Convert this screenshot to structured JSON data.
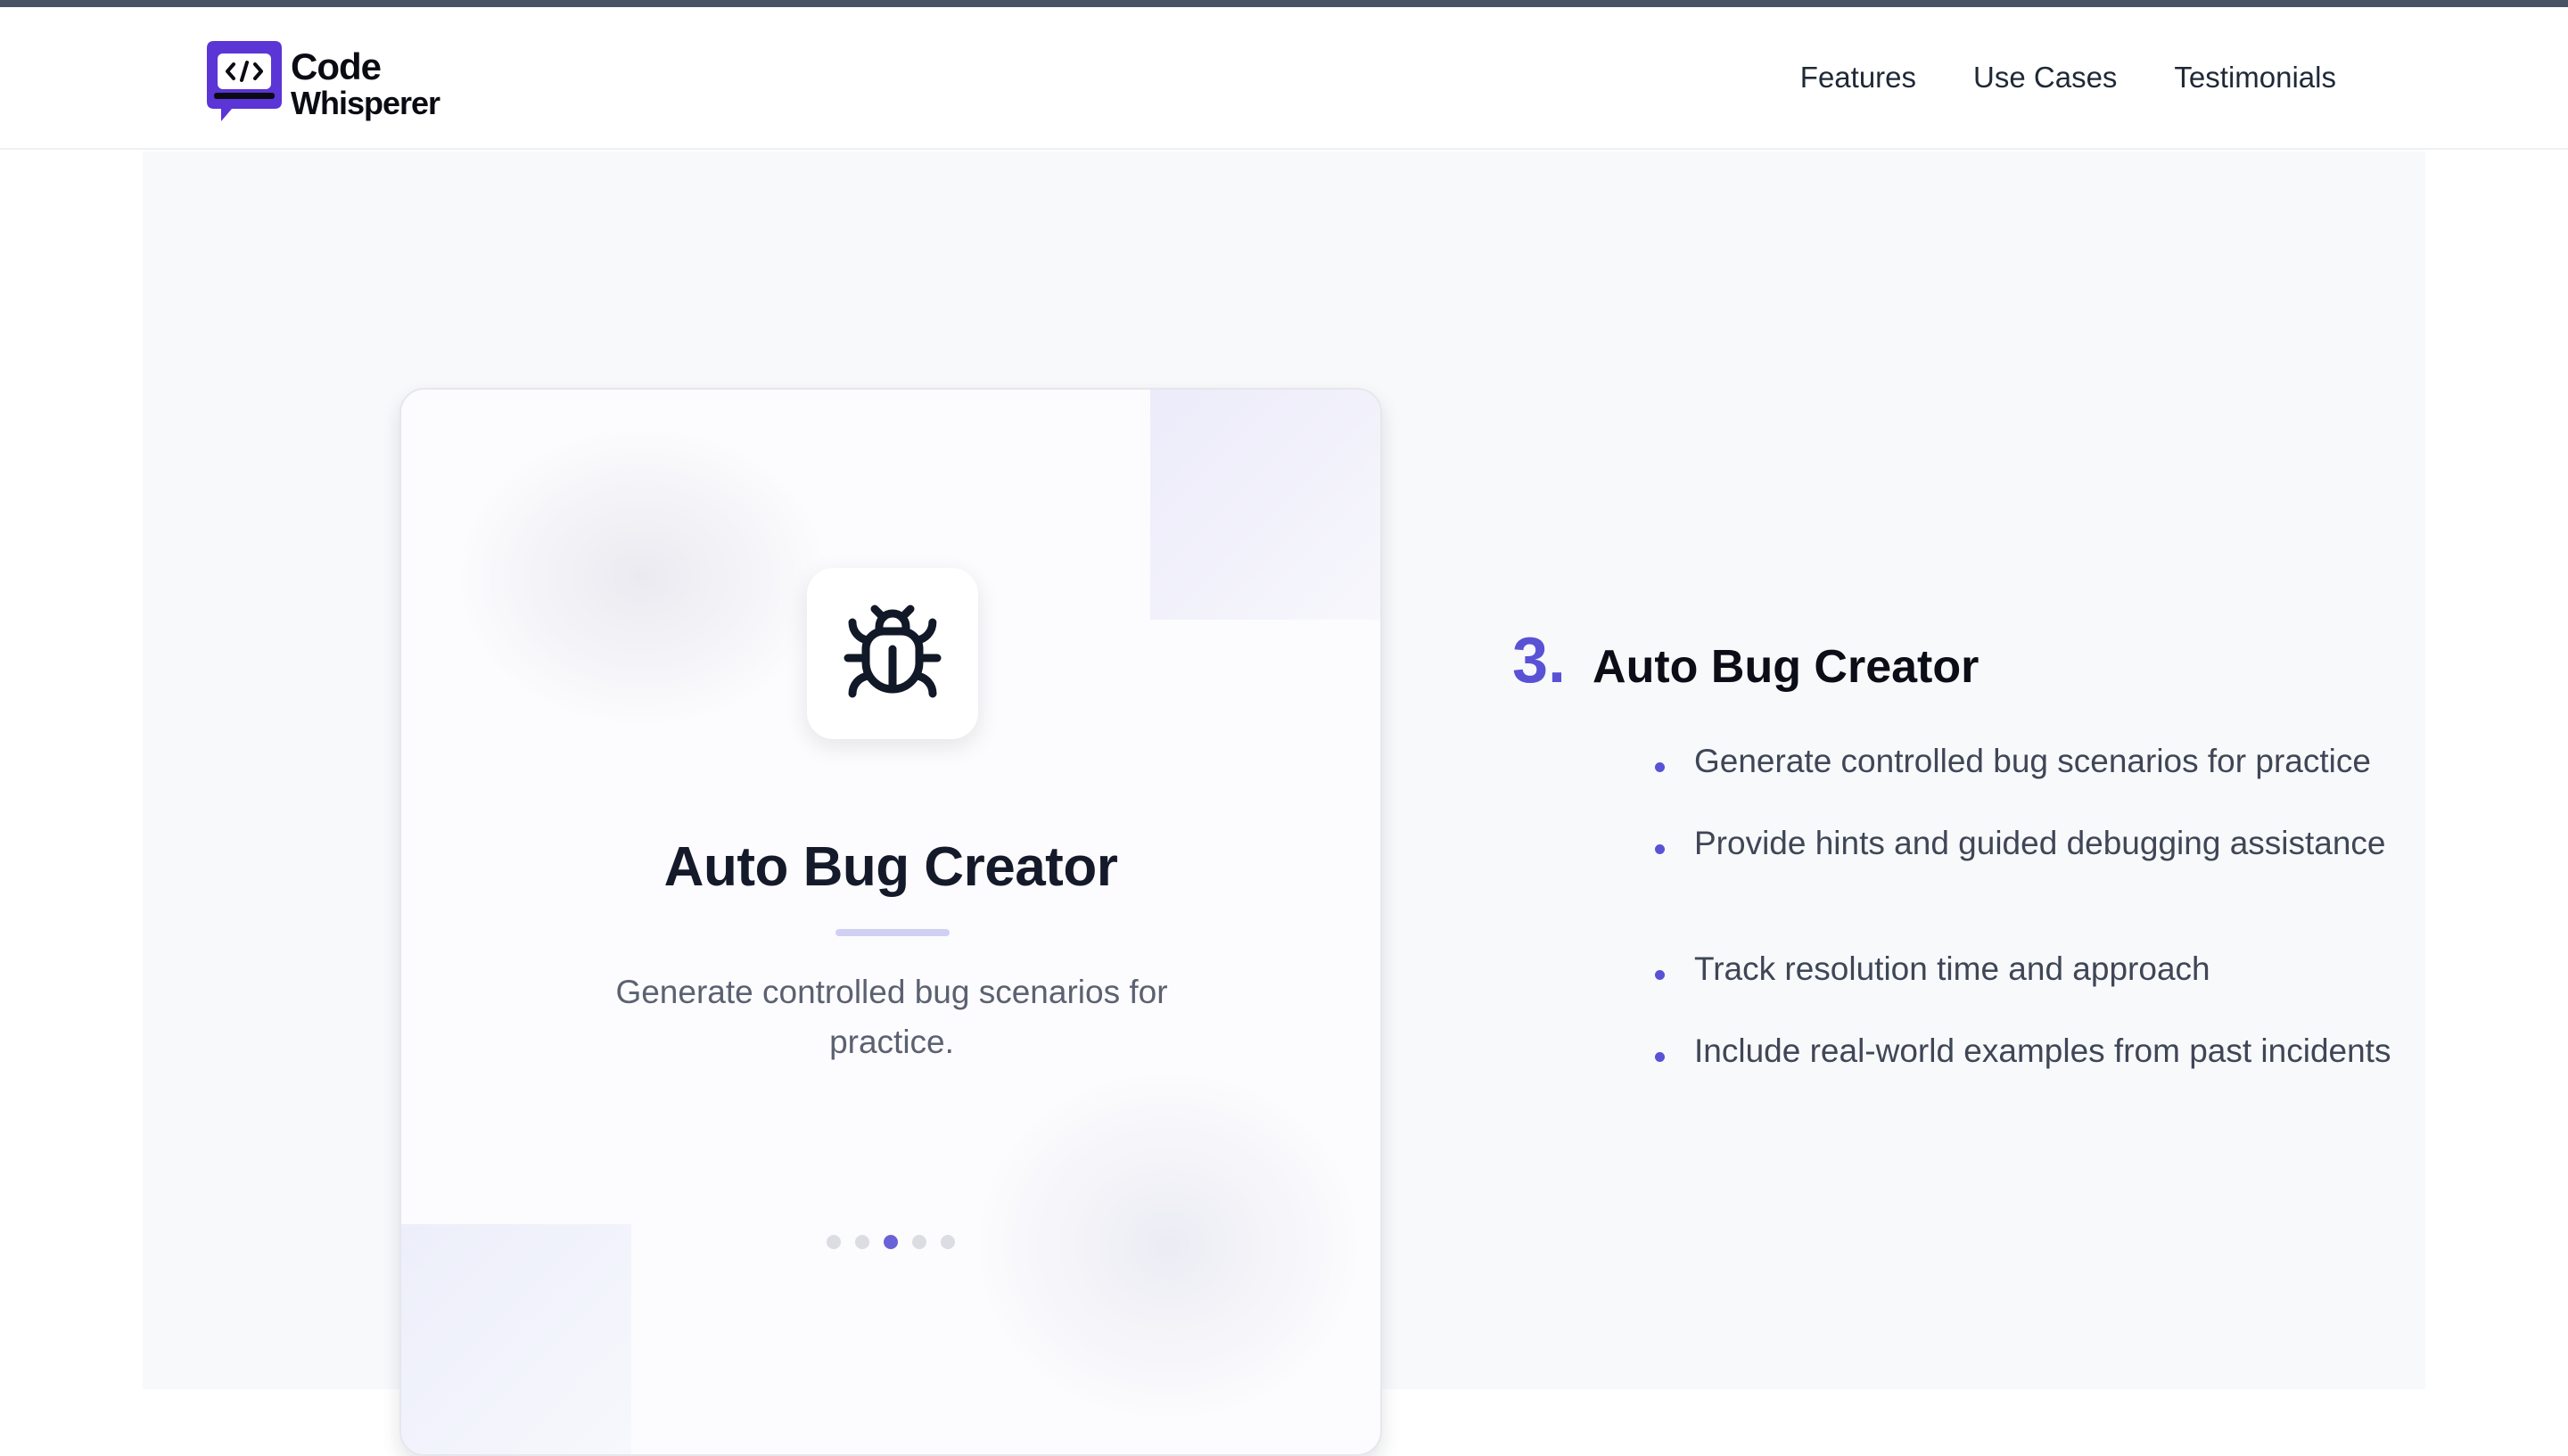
{
  "header": {
    "logo": {
      "line1": "Code",
      "line2": "Whisperer",
      "icon": "code-bubble-icon",
      "brand_color": "#5b35d5"
    },
    "nav": [
      {
        "label": "Features"
      },
      {
        "label": "Use Cases"
      },
      {
        "label": "Testimonials"
      }
    ]
  },
  "card": {
    "icon": "bug-icon",
    "title": "Auto Bug Creator",
    "description": "Generate controlled bug scenarios for practice.",
    "carousel": {
      "total": 5,
      "active_index": 3
    }
  },
  "detail": {
    "number": "3.",
    "title": "Auto Bug Creator",
    "bullets": [
      "Generate controlled bug scenarios for practice",
      "Provide hints and guided debugging assistance",
      "Track resolution time and approach",
      "Include real-world examples from past incidents"
    ]
  },
  "colors": {
    "accent": "#5a52d5",
    "background": "#f8f9fb",
    "text": "#111827"
  }
}
